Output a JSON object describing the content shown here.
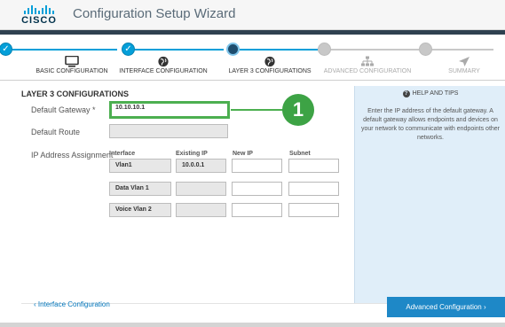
{
  "header": {
    "logo_text": "CISCO",
    "title": "Configuration Setup Wizard"
  },
  "steps": [
    {
      "label": "BASIC CONFIGURATION",
      "state": "done",
      "icon": "monitor-icon"
    },
    {
      "label": "INTERFACE CONFIGURATION",
      "state": "done",
      "icon": "globe-icon"
    },
    {
      "label": "LAYER 3 CONFIGURATIONS",
      "state": "current",
      "icon": "globe-icon"
    },
    {
      "label": "ADVANCED CONFIGURATION",
      "state": "future",
      "icon": "sitemap-icon"
    },
    {
      "label": "SUMMARY",
      "state": "future",
      "icon": "send-icon"
    }
  ],
  "form": {
    "section_title": "LAYER 3 CONFIGURATIONS",
    "default_gateway_label": "Default Gateway *",
    "default_gateway_value": "10.10.10.1",
    "default_route_label": "Default Route",
    "default_route_value": "",
    "ip_assignment_label": "IP Address Assignment",
    "columns": {
      "interface": "Interface",
      "existing_ip": "Existing IP",
      "new_ip": "New IP",
      "subnet": "Subnet"
    },
    "rows": [
      {
        "interface": "Vlan1",
        "existing_ip": "10.0.0.1",
        "new_ip": "",
        "subnet": ""
      },
      {
        "interface": "Data Vlan 1",
        "existing_ip": "",
        "new_ip": "",
        "subnet": ""
      },
      {
        "interface": "Voice Vlan 2",
        "existing_ip": "",
        "new_ip": "",
        "subnet": ""
      }
    ]
  },
  "callout": {
    "number": "1"
  },
  "help": {
    "title": "HELP AND TIPS",
    "text": "Enter the IP address of the default gateway. A default gateway allows endpoints and devices on your network to communicate with endpoints other networks."
  },
  "footer": {
    "back_label": "‹ Interface Configuration",
    "next_label": "Advanced Configuration ›"
  },
  "colors": {
    "accent": "#049fd9",
    "highlight": "#4caf50",
    "primary_button": "#1e88c7",
    "help_bg": "#e0eef9"
  }
}
